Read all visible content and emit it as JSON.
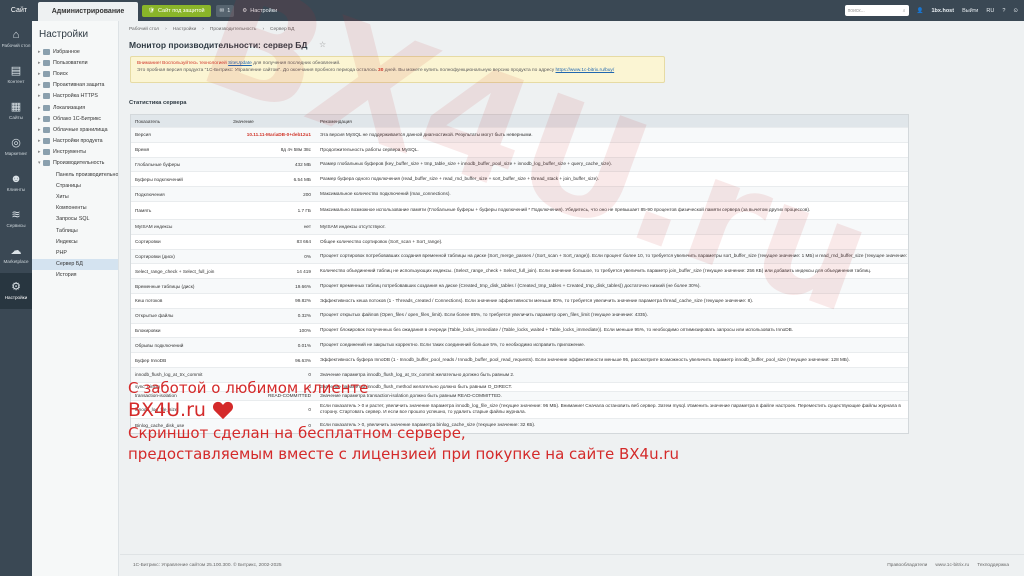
{
  "topbar": {
    "site": "Сайт",
    "admin": "Администрирование",
    "protect": "Сайт под защитой",
    "count": "1",
    "settings": "Настройки",
    "search_placeholder": "поиск...",
    "user": "1bx.host",
    "exit": "Выйти",
    "lang": "RU"
  },
  "iconbar": [
    {
      "icon": "desktop-icon",
      "label": "Рабочий стол"
    },
    {
      "icon": "content-icon",
      "label": "Контент"
    },
    {
      "icon": "sites-icon",
      "label": "Сайты"
    },
    {
      "icon": "marketing-icon",
      "label": "Маркетинг"
    },
    {
      "icon": "clients-icon",
      "label": "Клиенты"
    },
    {
      "icon": "services-icon",
      "label": "Сервисы"
    },
    {
      "icon": "marketplace-icon",
      "label": "Marketplace"
    },
    {
      "icon": "settings-icon",
      "label": "Настройки"
    }
  ],
  "menu": {
    "title": "Настройки",
    "items": [
      {
        "label": "Избранное",
        "sub": false
      },
      {
        "label": "Пользователи",
        "sub": false
      },
      {
        "label": "Поиск",
        "sub": false
      },
      {
        "label": "Проактивная защита",
        "sub": false
      },
      {
        "label": "Настройка HTTPS",
        "sub": false
      },
      {
        "label": "Локализация",
        "sub": false
      },
      {
        "label": "Облако 1С-Битрикс",
        "sub": false
      },
      {
        "label": "Облачные хранилища",
        "sub": false
      },
      {
        "label": "Настройки продукта",
        "sub": false
      },
      {
        "label": "Инструменты",
        "sub": false
      },
      {
        "label": "Производительность",
        "sub": false
      },
      {
        "label": "Панель производительности",
        "sub": true
      },
      {
        "label": "Страницы",
        "sub": true
      },
      {
        "label": "Хиты",
        "sub": true
      },
      {
        "label": "Компоненты",
        "sub": true
      },
      {
        "label": "Запросы SQL",
        "sub": true
      },
      {
        "label": "Таблицы",
        "sub": true
      },
      {
        "label": "Индексы",
        "sub": true
      },
      {
        "label": "PHP",
        "sub": true
      },
      {
        "label": "Сервер БД",
        "sub": true
      },
      {
        "label": "История",
        "sub": true
      }
    ]
  },
  "breadcrumbs": [
    "Рабочий стол",
    "Настройки",
    "Производительность",
    "Сервер БД"
  ],
  "page_title": "Монитор производительности: сервер БД",
  "notice": {
    "line1_red": "Внимание! Воспользуйтесь технологией",
    "line1_link": "SiteUpdate",
    "line1_tail": "для получения последних обновлений.",
    "line2": "Это пробная версия продукта \"1С-Битрикс: Управление сайтом\". До окончания пробного периода осталось",
    "days": "30",
    "line2_tail": "дней. Вы можете купить полнофункциональную версию продукта по адресу",
    "url": "https://www.1c-bitrix.ru/buy/"
  },
  "stat_title": "Статистика сервера",
  "table": {
    "headers": [
      "Показатель",
      "Значение",
      "Рекомендация"
    ],
    "rows": [
      {
        "name": "Версия",
        "value": "10.11.11-MariaDB-0+deb12u1",
        "red": true,
        "rec": "Эта версия MySQL не поддерживается данной диагностикой. Результаты могут быть неверными."
      },
      {
        "name": "Время",
        "value": "8д 4ч 58м 38с",
        "red": false,
        "rec": "Продолжительность работы сервера MySQL."
      },
      {
        "name": "Глобальные буферы",
        "value": "432 МБ",
        "red": false,
        "rec": "Размер глобальных буферов (key_buffer_size + tmp_table_size + innodb_buffer_pool_size + innodb_log_buffer_size + query_cache_size)."
      },
      {
        "name": "Буферы подключений",
        "value": "6.54 МБ",
        "red": false,
        "rec": "Размер буфера одного подключения (read_buffer_size + read_rnd_buffer_size + sort_buffer_size + thread_stack + join_buffer_size)."
      },
      {
        "name": "Подключения",
        "value": "200",
        "red": false,
        "rec": "Максимальное количество подключений (max_connections)."
      },
      {
        "name": "Память",
        "value": "1.7 ГБ",
        "red": false,
        "rec": "Максимально возможное использование памяти (Глобальные буферы + буферы подключений * Подключения). Убедитесь, что оно не превышает 85-90 процентов физической памяти сервера (за вычетом других процессов)."
      },
      {
        "name": "MyISAM индексы",
        "value": "нет",
        "red": false,
        "rec": "MyISAM индексы отсутствуют."
      },
      {
        "name": "Сортировки",
        "value": "83 664",
        "red": false,
        "rec": "Общее количество сортировок (Sort_scan + Sort_range)."
      },
      {
        "name": "Сортировки (диск)",
        "value": "0%",
        "red": false,
        "rec": "Процент сортировок потребовавших создания временной таблицы на диске (Sort_merge_passes / (Sort_scan + Sort_range)). Если процент более 10, то требуется увеличить параметры sort_buffer_size (текущее значение: 1 МБ) и read_rnd_buffer_size (текущее значение: 4 МБ)."
      },
      {
        "name": "Select_range_check + Select_full_join",
        "value": "14 419",
        "red": false,
        "rec": "Количество объединений таблиц не использующих индексы. (Select_range_check + Select_full_join). Если значение большое, то требуется увеличить параметр join_buffer_size (текущее значение: 256 КБ) или добавить индексы для объединения таблиц."
      },
      {
        "name": "Временные таблицы (диск)",
        "value": "19.66%",
        "red": false,
        "rec": "Процент временных таблиц потребовавших создания на диске (Created_tmp_disk_tables / (Created_tmp_tables + Created_tmp_disk_tables)) достаточно низкий (не более 30%)."
      },
      {
        "name": "Кеш потоков",
        "value": "99.82%",
        "red": false,
        "rec": "Эффективность кеша потоков (1 - Threads_created / Connections). Если значение эффективности меньше 80%, то требуется увеличить значение параметра thread_cache_size (текущее значение: 8)."
      },
      {
        "name": "Открытые файлы",
        "value": "0.32%",
        "red": false,
        "rec": "Процент открытых файлов (Open_files / open_files_limit). Если более 85%, то требуется увеличить параметр open_files_limit (текущее значение: 4335)."
      },
      {
        "name": "Блокировки",
        "value": "100%",
        "red": false,
        "rec": "Процент блокировок полученных без ожидания в очереди (Table_locks_immediate / (Table_locks_waited + Table_locks_immediate)). Если меньше 95%, то необходимо оптимизировать запросы или использовать InnoDB."
      },
      {
        "name": "Обрывы подключений",
        "value": "0.01%",
        "red": false,
        "rec": "Процент соединений не закрытых корректно. Если таких соединений больше 5%, то необходимо исправить приложение."
      },
      {
        "name": "Буфер InnoDB",
        "value": "96.63%",
        "red": false,
        "rec": "Эффективность буфера InnoDB (1 - Innodb_buffer_pool_reads / Innodb_buffer_pool_read_requests). Если значение эффективности меньше 95, рассмотрите возможность увеличить параметр innodb_buffer_pool_size (текущее значение: 128 МБ)."
      },
      {
        "name": "innodb_flush_log_at_trx_commit",
        "value": "0",
        "red": false,
        "rec": "Значение параметра innodb_flush_log_at_trx_commit желательно должно быть равным 2."
      },
      {
        "name": "sync_binlog",
        "value": "0",
        "red": false,
        "rec": "Значение параметра innodb_flush_method желательно должно быть равным O_DIRECT."
      },
      {
        "name": "transaction-isolation",
        "value": "READ-COMMITTED",
        "red": false,
        "rec": "Значение параметра transaction-isolation должно быть равным READ-COMMITTED."
      },
      {
        "name": "innodb_log_file_size",
        "value": "0",
        "red": false,
        "rec": "Если показатель > 0 и растет, увеличить значение параметра innodb_log_file_size (текущее значение: 96 МБ). Внимание! Сначала остановить веб сервер. Затем mysql. Изменить значение параметра в файле настроек. Переместить существующие файлы журнала в сторону. Стартовать сервер. И если все прошло успешно, то удалить старые файлы журнала."
      },
      {
        "name": "Binlog_cache_disk_use",
        "value": "0",
        "red": false,
        "rec": "Если показатель > 0, увеличить значение параметра binlog_cache_size (текущее значение: 32 КБ)."
      }
    ]
  },
  "footer": {
    "copyright": "1С-Битрикс: Управление сайтом 25.100.300. © Битрикс, 2002-2025",
    "links": [
      "Правообладатели",
      "www.1c-bitrix.ru",
      "Техподдержка"
    ]
  },
  "watermark": {
    "line1": "С заботой о любимом клиенте",
    "line2": "BX4U.ru",
    "line3": "Скриншот сделан на бесплатном сервере,",
    "line4": "предоставляемым вместе с лицензией при покупке на сайте BX4u.ru",
    "big": "BX4U.ru"
  },
  "colors": {
    "accent": "#8ab529",
    "dark": "#3a4854",
    "warning_red": "#d0362a",
    "watermark": "#d42a2a"
  }
}
